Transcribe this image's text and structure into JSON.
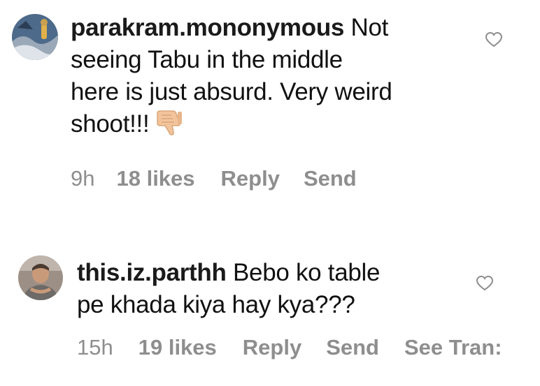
{
  "comments": [
    {
      "username": "parakram.mononymous",
      "lines": [
        "Not",
        "seeing Tabu in the middle",
        "here is just absurd. Very weird",
        "shoot!!!"
      ],
      "emoji": "thumbs-down-icon",
      "time": "9h",
      "likes": "18 likes",
      "reply": "Reply",
      "send": "Send"
    },
    {
      "username": "this.iz.parthh",
      "lines": [
        "Bebo ko table",
        "pe khada kiya hay kya???"
      ],
      "time": "15h",
      "likes": "19 likes",
      "reply": "Reply",
      "send": "Send",
      "see_translation": "See Tran:"
    }
  ],
  "colors": {
    "text": "#111111",
    "meta": "#8e8e8e",
    "heart": "#8e8e8e",
    "emoji_skin": "#f5c9a0"
  }
}
